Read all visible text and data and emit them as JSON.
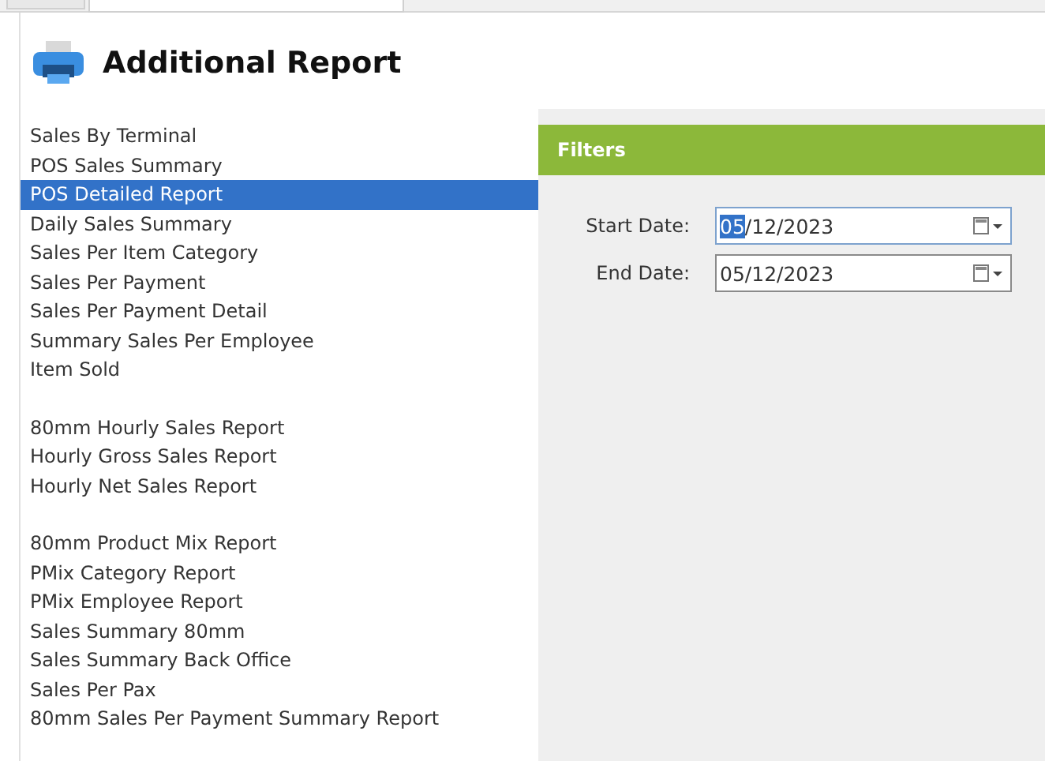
{
  "tabs": [
    {
      "selected": false
    },
    {
      "selected": true
    }
  ],
  "header": {
    "title": "Additional Report"
  },
  "report_groups": [
    {
      "items": [
        {
          "label": "Sales By Terminal",
          "selected": false
        },
        {
          "label": "POS Sales Summary",
          "selected": false
        },
        {
          "label": "POS Detailed Report",
          "selected": true
        },
        {
          "label": "Daily Sales Summary",
          "selected": false
        },
        {
          "label": "Sales Per Item Category",
          "selected": false
        },
        {
          "label": "Sales Per Payment",
          "selected": false
        },
        {
          "label": "Sales Per Payment Detail",
          "selected": false
        },
        {
          "label": "Summary Sales Per Employee",
          "selected": false
        },
        {
          "label": "Item Sold",
          "selected": false
        }
      ]
    },
    {
      "items": [
        {
          "label": "80mm Hourly Sales Report",
          "selected": false
        },
        {
          "label": "Hourly Gross Sales Report",
          "selected": false
        },
        {
          "label": "Hourly Net Sales Report",
          "selected": false
        }
      ]
    },
    {
      "items": [
        {
          "label": "80mm Product Mix Report",
          "selected": false
        },
        {
          "label": "PMix Category Report",
          "selected": false
        },
        {
          "label": "PMix Employee Report",
          "selected": false
        },
        {
          "label": "Sales Summary 80mm",
          "selected": false
        },
        {
          "label": "Sales Summary Back Office",
          "selected": false
        },
        {
          "label": "Sales Per Pax",
          "selected": false
        },
        {
          "label": "80mm Sales Per Payment Summary Report",
          "selected": false
        }
      ]
    }
  ],
  "filters": {
    "title": "Filters",
    "fields": [
      {
        "label": "Start Date:",
        "value_parts": [
          {
            "text": "05",
            "selected": true
          },
          {
            "text": "/12/2023",
            "selected": false
          }
        ],
        "focused": true
      },
      {
        "label": "End Date:",
        "value": "05/12/2023",
        "focused": false
      }
    ]
  }
}
